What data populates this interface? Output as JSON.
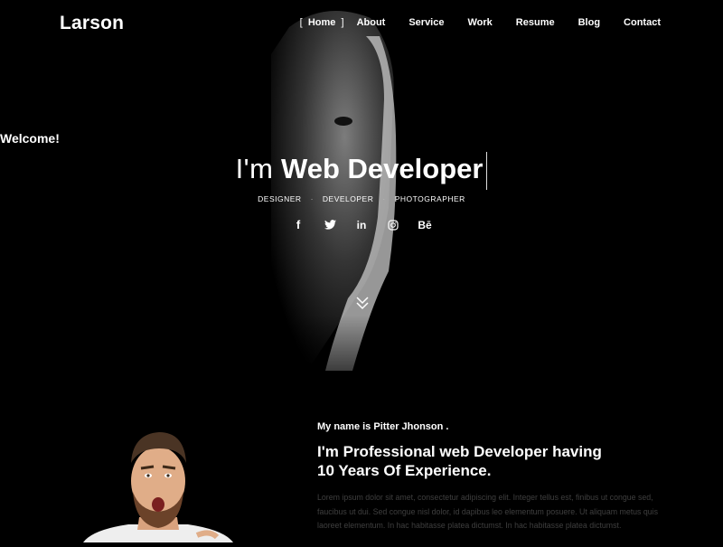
{
  "brand": {
    "name": "Larson"
  },
  "nav": {
    "items": [
      {
        "label": "Home",
        "active": true
      },
      {
        "label": "About"
      },
      {
        "label": "Service"
      },
      {
        "label": "Work"
      },
      {
        "label": "Resume"
      },
      {
        "label": "Blog"
      },
      {
        "label": "Contact"
      }
    ],
    "active_left": "[",
    "active_right": "]"
  },
  "hero": {
    "welcome": "Welcome!",
    "prefix": "I'm",
    "title": "Web Developer",
    "roles": [
      "DESIGNER",
      "DEVELOPER",
      "PHOTOGRAPHER"
    ],
    "role_separator": "·",
    "social": [
      {
        "icon": "facebook-icon",
        "glyph": "f"
      },
      {
        "icon": "twitter-icon",
        "glyph": ""
      },
      {
        "icon": "linkedin-icon",
        "glyph": "in"
      },
      {
        "icon": "instagram-icon",
        "glyph": ""
      },
      {
        "icon": "behance-icon",
        "glyph": "Bē"
      }
    ]
  },
  "about": {
    "intro": "My name is Pitter Jhonson .",
    "headline_line1": "I'm Professional web Developer having",
    "headline_line2": "10 Years Of Experience.",
    "body": "Lorem ipsum dolor sit amet, consectetur adipiscing elit. Integer tellus est, finibus ut congue sed, faucibus ut dui. Sed congue nisl dolor, id dapibus leo elementum posuere. Ut aliquam metus quis laoreet elementum. In hac habitasse platea dictumst. In hac habitasse platea dictumst."
  },
  "colors": {
    "background": "#000000",
    "text": "#ffffff",
    "muted": "#3f3f3f"
  }
}
